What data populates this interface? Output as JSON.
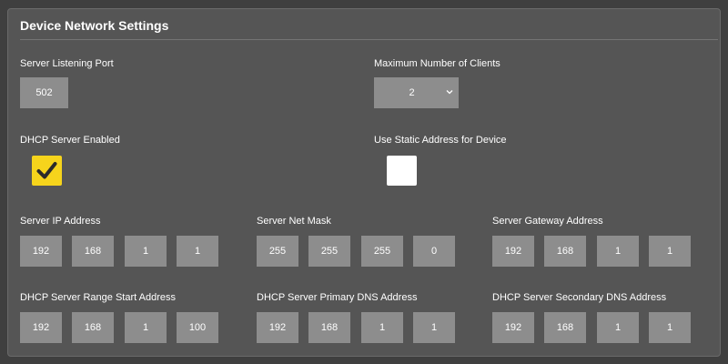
{
  "panel": {
    "title": "Device Network Settings"
  },
  "server_port": {
    "label": "Server Listening Port",
    "value": "502"
  },
  "max_clients": {
    "label": "Maximum Number of Clients",
    "selected": "2"
  },
  "dhcp_enabled": {
    "label": "DHCP Server Enabled",
    "checked": true,
    "color": "#f6d41c"
  },
  "static_address": {
    "label": "Use Static Address for Device",
    "checked": false
  },
  "server_ip": {
    "label": "Server IP Address",
    "octets": [
      "192",
      "168",
      "1",
      "1"
    ]
  },
  "net_mask": {
    "label": "Server Net Mask",
    "octets": [
      "255",
      "255",
      "255",
      "0"
    ]
  },
  "gateway": {
    "label": "Server Gateway Address",
    "octets": [
      "192",
      "168",
      "1",
      "1"
    ]
  },
  "dhcp_range_start": {
    "label": "DHCP Server Range Start Address",
    "octets": [
      "192",
      "168",
      "1",
      "100"
    ]
  },
  "primary_dns": {
    "label": "DHCP Server Primary DNS Address",
    "octets": [
      "192",
      "168",
      "1",
      "1"
    ]
  },
  "secondary_dns": {
    "label": "DHCP Server Secondary DNS Address",
    "octets": [
      "192",
      "168",
      "1",
      "1"
    ]
  },
  "icons": {
    "check": "checkmark-icon",
    "dropdown": "chevron-down-icon"
  }
}
